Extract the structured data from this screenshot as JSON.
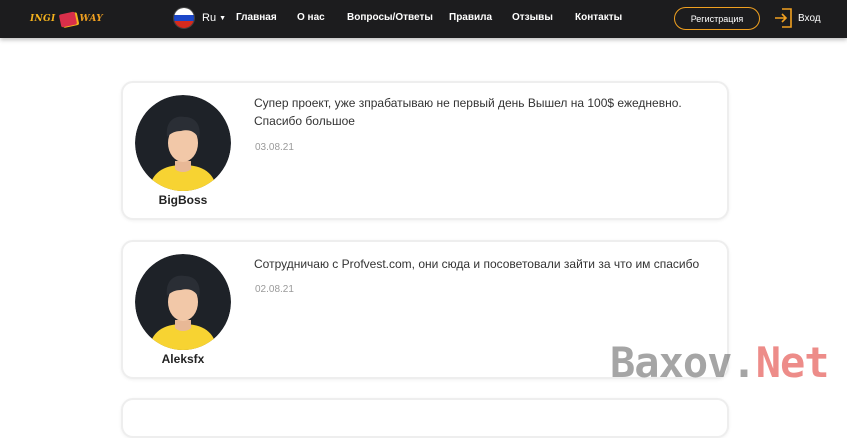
{
  "header": {
    "logo": {
      "text_left": "INGI",
      "text_right": "WAY"
    },
    "language": {
      "code": "Ru",
      "flag": "russia-flag"
    },
    "nav": [
      {
        "label": "Главная"
      },
      {
        "label": "О нас"
      },
      {
        "label": "Вопросы/Ответы"
      },
      {
        "label": "Правила"
      },
      {
        "label": "Отзывы"
      },
      {
        "label": "Контакты"
      }
    ],
    "register_label": "Регистрация",
    "login_label": "Вход",
    "login_icon": "login-icon"
  },
  "reviews": [
    {
      "name": "BigBoss",
      "text": "Супер проект, уже зпрабатываю не первый день Вышел на 100$ ежедневно. Спасибо большое",
      "date": "03.08.21"
    },
    {
      "name": "Aleksfx",
      "text": "Сотрудничаю с Profvest.com, они сюда и посоветовали зайти за что им спасибо",
      "date": "02.08.21"
    }
  ],
  "watermark": {
    "part1": "Baxov.",
    "part2": "Net"
  },
  "colors": {
    "header_bg": "#1c1c1e",
    "accent": "#f0a020",
    "avatar_bg": "#1e2228",
    "avatar_shirt": "#f7d332",
    "avatar_skin": "#f2c8a8",
    "avatar_hair": "#2a2e35"
  }
}
